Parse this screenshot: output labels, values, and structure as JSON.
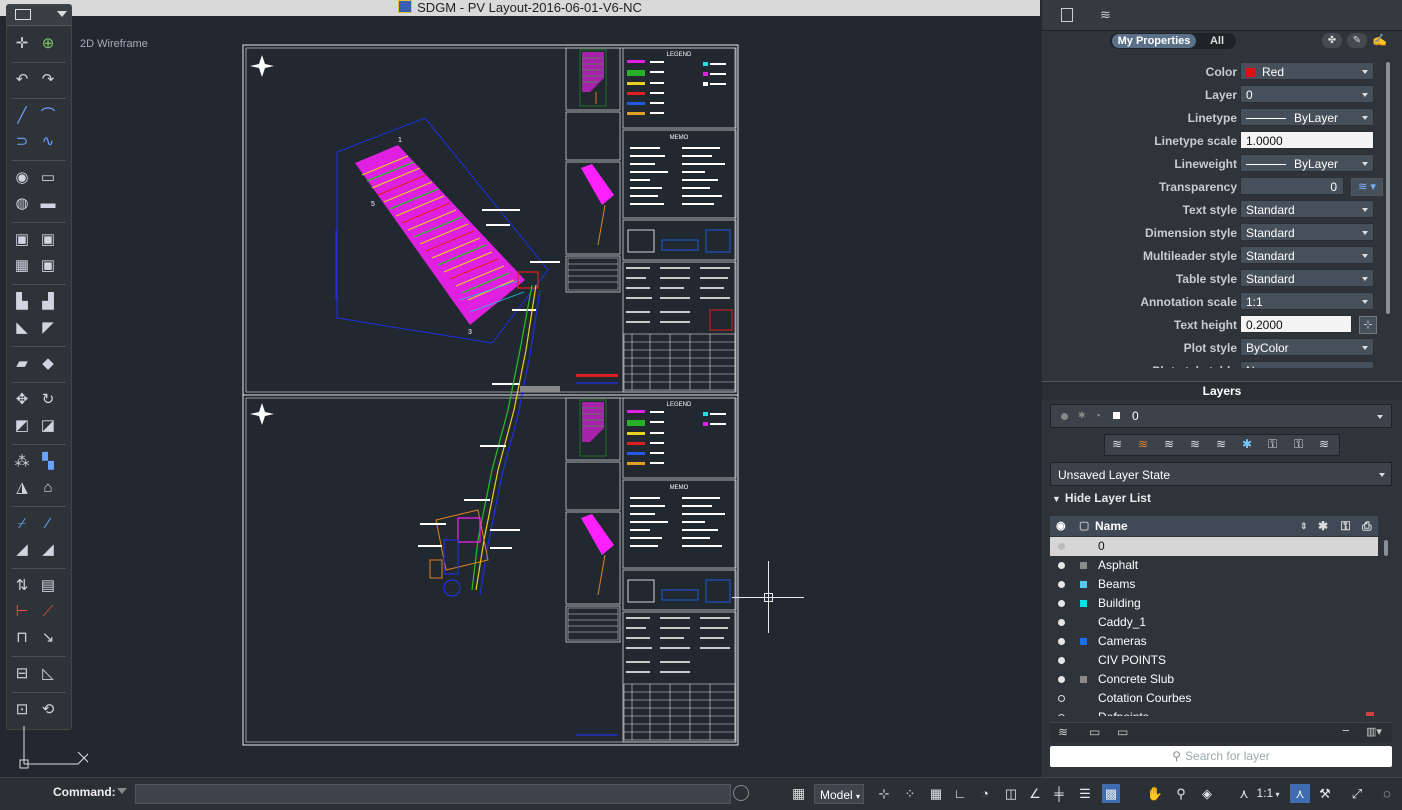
{
  "window": {
    "title": "SDGM  -      PV Layout-2016-06-01-V6-NC"
  },
  "viewport": {
    "label": "2D Wireframe"
  },
  "properties": {
    "tabs": [
      "My Properties",
      "All"
    ],
    "rows": [
      {
        "label": "Color",
        "value": "Red",
        "swatch": "#e01010"
      },
      {
        "label": "Layer",
        "value": "0"
      },
      {
        "label": "Linetype",
        "value": "ByLayer",
        "line": true
      },
      {
        "label": "Linetype scale",
        "value": "1.0000"
      },
      {
        "label": "Lineweight",
        "value": "ByLayer",
        "line": true
      },
      {
        "label": "Transparency",
        "value": "0"
      },
      {
        "label": "Text style",
        "value": "Standard"
      },
      {
        "label": "Dimension style",
        "value": "Standard"
      },
      {
        "label": "Multileader style",
        "value": "Standard"
      },
      {
        "label": "Table style",
        "value": "Standard"
      },
      {
        "label": "Annotation scale",
        "value": "1:1"
      },
      {
        "label": "Text height",
        "value": "0.2000"
      },
      {
        "label": "Plot style",
        "value": "ByColor"
      },
      {
        "label": "Plot style table",
        "value": "None"
      }
    ]
  },
  "layers": {
    "title": "Layers",
    "current": "0",
    "state": "Unsaved Layer State",
    "toggle": "Hide Layer List",
    "column_name": "Name",
    "items": [
      {
        "name": "0",
        "color": "",
        "on": false,
        "selected": true
      },
      {
        "name": "Asphalt",
        "color": "#8a8a8a",
        "on": true
      },
      {
        "name": "Beams",
        "color": "#59c8f0",
        "on": true
      },
      {
        "name": "Building",
        "color": "#00e5e5",
        "on": true
      },
      {
        "name": "Caddy_1",
        "color": "",
        "on": true
      },
      {
        "name": "Cameras",
        "color": "#1a6ee8",
        "on": true
      },
      {
        "name": "CIV POINTS",
        "color": "",
        "on": true
      },
      {
        "name": "Concrete Slub",
        "color": "#8a8a8a",
        "on": true
      },
      {
        "name": "Cotation Courbes",
        "color": "",
        "on": false
      },
      {
        "name": "Defpoints",
        "color": "",
        "on": false
      }
    ],
    "search_placeholder": "Search for layer"
  },
  "command": {
    "label": "Command:"
  },
  "status": {
    "model": "Model",
    "scale": "1:1"
  },
  "sheets": {
    "legend_title": "LEGEND",
    "memo_title": "MEMO"
  }
}
